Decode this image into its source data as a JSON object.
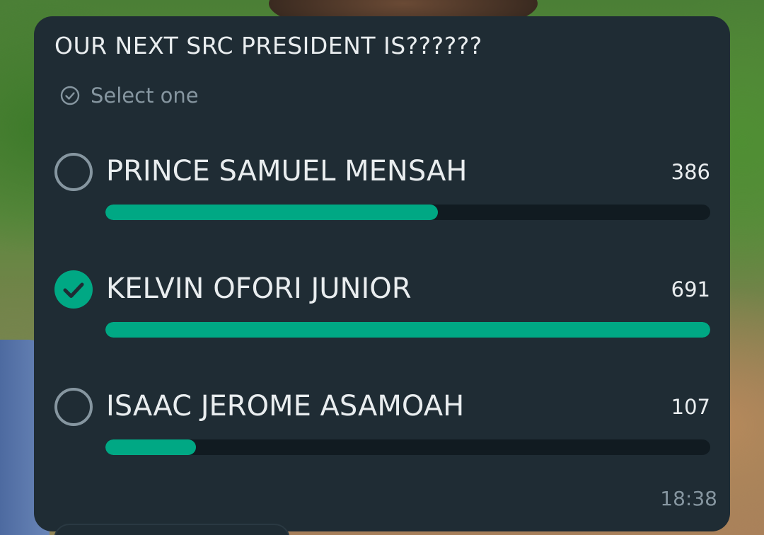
{
  "poll": {
    "question": "OUR NEXT SRC PRESIDENT IS??????",
    "hint": "Select one",
    "hint_icon": "check-circle-icon",
    "timestamp": "18:38",
    "accent_color": "#00a884",
    "options": [
      {
        "label": "PRINCE SAMUEL MENSAH",
        "votes": "386",
        "selected": false,
        "fill_fraction": 0.55
      },
      {
        "label": "KELVIN OFORI JUNIOR",
        "votes": "691",
        "selected": true,
        "fill_fraction": 1.0
      },
      {
        "label": "ISAAC JEROME ASAMOAH",
        "votes": "107",
        "selected": false,
        "fill_fraction": 0.15
      }
    ]
  }
}
